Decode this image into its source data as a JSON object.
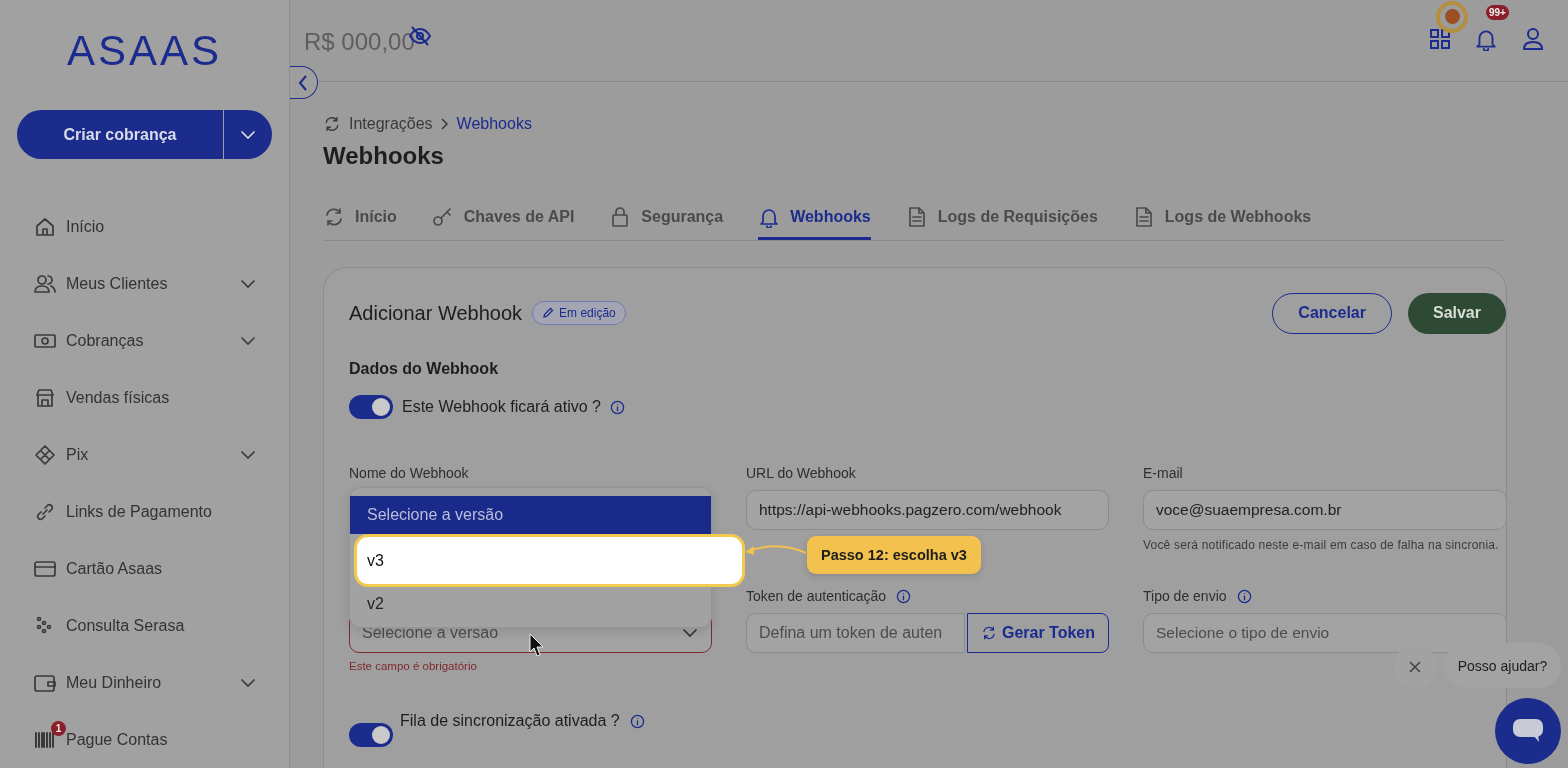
{
  "sidebar": {
    "logo": "ASAAS",
    "create_button": "Criar cobrança",
    "items": [
      {
        "label": "Início",
        "expandable": false
      },
      {
        "label": "Meus Clientes",
        "expandable": true
      },
      {
        "label": "Cobranças",
        "expandable": true
      },
      {
        "label": "Vendas físicas",
        "expandable": false
      },
      {
        "label": "Pix",
        "expandable": true
      },
      {
        "label": "Links de Pagamento",
        "expandable": false
      },
      {
        "label": "Cartão Asaas",
        "expandable": false
      },
      {
        "label": "Consulta Serasa",
        "expandable": false
      },
      {
        "label": "Meu Dinheiro",
        "expandable": true
      },
      {
        "label": "Pague Contas",
        "expandable": false,
        "badge": "1"
      }
    ]
  },
  "header": {
    "balance": "R$ 000,00",
    "notification_badge": "99+"
  },
  "breadcrumb": [
    "Integrações",
    "Webhooks"
  ],
  "page_title": "Webhooks",
  "tabs": [
    {
      "label": "Início",
      "selected": false
    },
    {
      "label": "Chaves de API",
      "selected": false
    },
    {
      "label": "Segurança",
      "selected": false
    },
    {
      "label": "Webhooks",
      "selected": true
    },
    {
      "label": "Logs de Requisições",
      "selected": false
    },
    {
      "label": "Logs de Webhooks",
      "selected": false
    }
  ],
  "card": {
    "title": "Adicionar Webhook",
    "status_badge": "Em edição",
    "buttons": [
      {
        "label": "Cancelar",
        "kind": "outline"
      },
      {
        "label": "Salvar",
        "kind": "primary"
      }
    ],
    "section_title": "Dados do Webhook",
    "active_toggle": {
      "label": "Este Webhook ficará ativo ?",
      "on": true,
      "info": true
    },
    "fields": [
      {
        "kind": "menu",
        "label": "Nome do Webhook"
      },
      {
        "kind": "text",
        "label": "URL do Webhook",
        "value": "https://api-webhooks.pagzero.com/webhook"
      },
      {
        "kind": "text",
        "label": "E-mail",
        "value": "voce@suaempresa.com.br",
        "hint": "Você será notificado neste e-mail em caso de falha na sincronia."
      },
      {
        "kind": "select",
        "placeholder": "Selecione a versão",
        "error": "Este campo é obrigatório"
      },
      {
        "kind": "token",
        "label": "Token de autenticação",
        "info": true,
        "placeholder": "Defina um token de auten",
        "button": "Gerar Token"
      },
      {
        "kind": "text",
        "label": "Tipo de envio",
        "info": true,
        "placeholder": "Selecione o tipo de envio"
      }
    ],
    "queue_toggle": {
      "label": "Fila de sincronização ativada ?",
      "on": true,
      "info": true
    }
  },
  "version_menu": {
    "options": [
      {
        "label": "Selecione a versão",
        "selected": true,
        "highlighted": false
      },
      {
        "label": "v3",
        "selected": false,
        "highlighted": true
      },
      {
        "label": "v2",
        "selected": false,
        "highlighted": false
      }
    ]
  },
  "tooltip": "Passo 12: escolha v3",
  "chat": {
    "prompt": "Posso ajudar?"
  }
}
